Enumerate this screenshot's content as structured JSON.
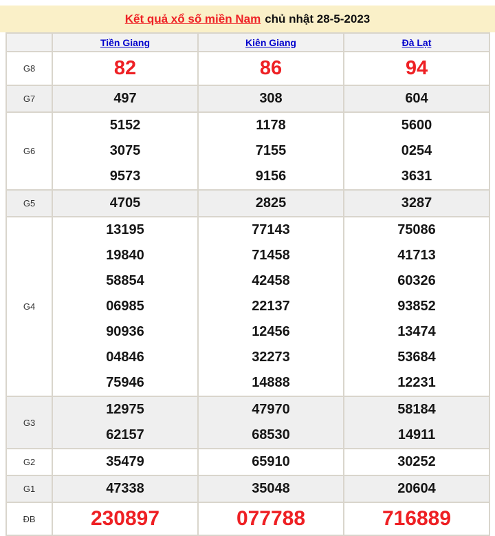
{
  "title": {
    "link_text": "Kết quả xổ số miền Nam",
    "date_text": "chủ nhật 28-5-2023"
  },
  "colors": {
    "red": "#ee2024",
    "link_blue": "#0000cc",
    "band_bg": "#faf0c8",
    "border": "#d9d5cc",
    "row_alt_bg": "#efefef",
    "header_bg": "#f2f2f2"
  },
  "table": {
    "columns": [
      "Tiền Giang",
      "Kiên Giang",
      "Đà Lạt"
    ],
    "rows": [
      {
        "label": "G8",
        "highlight": true,
        "cells": [
          [
            "82"
          ],
          [
            "86"
          ],
          [
            "94"
          ]
        ]
      },
      {
        "label": "G7",
        "highlight": false,
        "cells": [
          [
            "497"
          ],
          [
            "308"
          ],
          [
            "604"
          ]
        ]
      },
      {
        "label": "G6",
        "highlight": false,
        "cells": [
          [
            "5152",
            "3075",
            "9573"
          ],
          [
            "1178",
            "7155",
            "9156"
          ],
          [
            "5600",
            "0254",
            "3631"
          ]
        ]
      },
      {
        "label": "G5",
        "highlight": false,
        "cells": [
          [
            "4705"
          ],
          [
            "2825"
          ],
          [
            "3287"
          ]
        ]
      },
      {
        "label": "G4",
        "highlight": false,
        "cells": [
          [
            "13195",
            "19840",
            "58854",
            "06985",
            "90936",
            "04846",
            "75946"
          ],
          [
            "77143",
            "71458",
            "42458",
            "22137",
            "12456",
            "32273",
            "14888"
          ],
          [
            "75086",
            "41713",
            "60326",
            "93852",
            "13474",
            "53684",
            "12231"
          ]
        ]
      },
      {
        "label": "G3",
        "highlight": false,
        "cells": [
          [
            "12975",
            "62157"
          ],
          [
            "47970",
            "68530"
          ],
          [
            "58184",
            "14911"
          ]
        ]
      },
      {
        "label": "G2",
        "highlight": false,
        "cells": [
          [
            "35479"
          ],
          [
            "65910"
          ],
          [
            "30252"
          ]
        ]
      },
      {
        "label": "G1",
        "highlight": false,
        "cells": [
          [
            "47338"
          ],
          [
            "35048"
          ],
          [
            "20604"
          ]
        ]
      },
      {
        "label": "ĐB",
        "highlight": true,
        "cells": [
          [
            "230897"
          ],
          [
            "077788"
          ],
          [
            "716889"
          ]
        ]
      }
    ]
  }
}
